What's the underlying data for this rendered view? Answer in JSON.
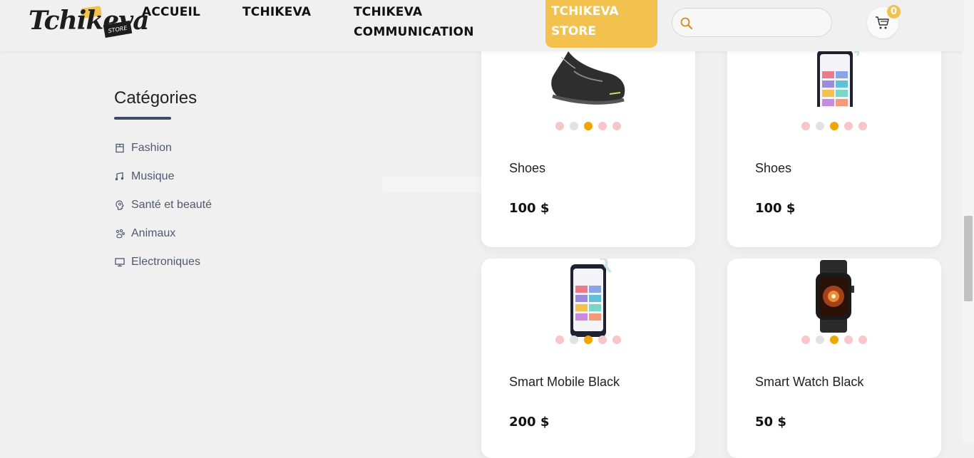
{
  "header": {
    "logo_text": "Tchikeva",
    "logo_tag": "STORE",
    "nav": [
      {
        "label": "ACCUEIL"
      },
      {
        "label": "TCHIKEVA"
      },
      {
        "label_line1": "TCHIKEVA",
        "label_line2": "COMMUNICATION"
      },
      {
        "label_line1": "TCHIKEVA",
        "label_line2": "STORE",
        "active": true
      }
    ],
    "search": {
      "placeholder": "",
      "value": ""
    },
    "cart_count": "0"
  },
  "sidebar": {
    "title": "Catégories",
    "items": [
      {
        "label": "Fashion",
        "icon": "shirt-icon"
      },
      {
        "label": "Musique",
        "icon": "music-icon"
      },
      {
        "label": "Santé et beauté",
        "icon": "head-icon"
      },
      {
        "label": "Animaux",
        "icon": "paw-icon"
      },
      {
        "label": "Electroniques",
        "icon": "monitor-icon"
      }
    ]
  },
  "products": [
    {
      "name": "Shoes",
      "price": "100 $",
      "image": "sneaker"
    },
    {
      "name": "Shoes",
      "price": "100 $",
      "image": "phone"
    },
    {
      "name": "Smart Mobile Black",
      "price": "200 $",
      "image": "phone"
    },
    {
      "name": "Smart Watch Black",
      "price": "50 $",
      "image": "watch"
    }
  ],
  "carousel": {
    "active_index": 2,
    "count": 5
  },
  "colors": {
    "accent": "#f2c14e",
    "dot_inactive": "#f7c6c9",
    "dot_grey": "#e2e2e2",
    "dot_active": "#f0a500",
    "category_text": "#4d5a70"
  }
}
